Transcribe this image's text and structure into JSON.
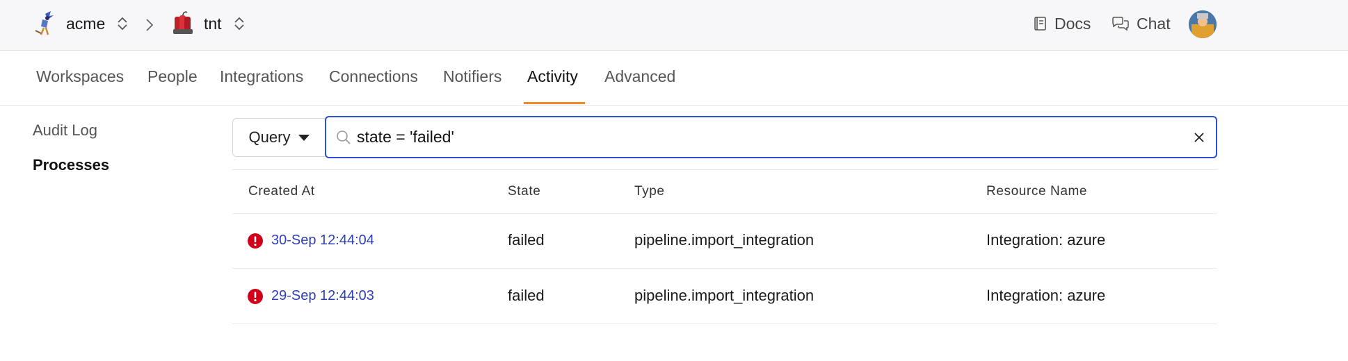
{
  "header": {
    "org": "acme",
    "project": "tnt",
    "docs_label": "Docs",
    "chat_label": "Chat"
  },
  "tabs": [
    {
      "label": "Workspaces"
    },
    {
      "label": "People"
    },
    {
      "label": "Integrations"
    },
    {
      "label": "Connections"
    },
    {
      "label": "Notifiers"
    },
    {
      "label": "Activity",
      "active": true
    },
    {
      "label": "Advanced"
    }
  ],
  "sidebar": {
    "items": [
      {
        "label": "Audit Log"
      },
      {
        "label": "Processes",
        "active": true
      }
    ]
  },
  "search": {
    "mode_label": "Query",
    "value": "state = 'failed'"
  },
  "table": {
    "columns": [
      "Created At",
      "State",
      "Type",
      "Resource Name"
    ],
    "rows": [
      {
        "created_at": "30-Sep 12:44:04",
        "state": "failed",
        "type": "pipeline.import_integration",
        "resource": "Integration: azure"
      },
      {
        "created_at": "29-Sep 12:44:03",
        "state": "failed",
        "type": "pipeline.import_integration",
        "resource": "Integration: azure"
      }
    ]
  },
  "colors": {
    "accent": "#f08a24",
    "focus": "#2d4fd6",
    "link": "#2f3fb8",
    "error": "#d0021b"
  },
  "icons": [
    "roadrunner-logo",
    "dynamite-logo",
    "updown-icon",
    "chevron-right-icon",
    "book-icon",
    "chat-bubbles-icon",
    "user-avatar",
    "search-icon",
    "close-icon",
    "error-icon",
    "caret-down-icon"
  ]
}
